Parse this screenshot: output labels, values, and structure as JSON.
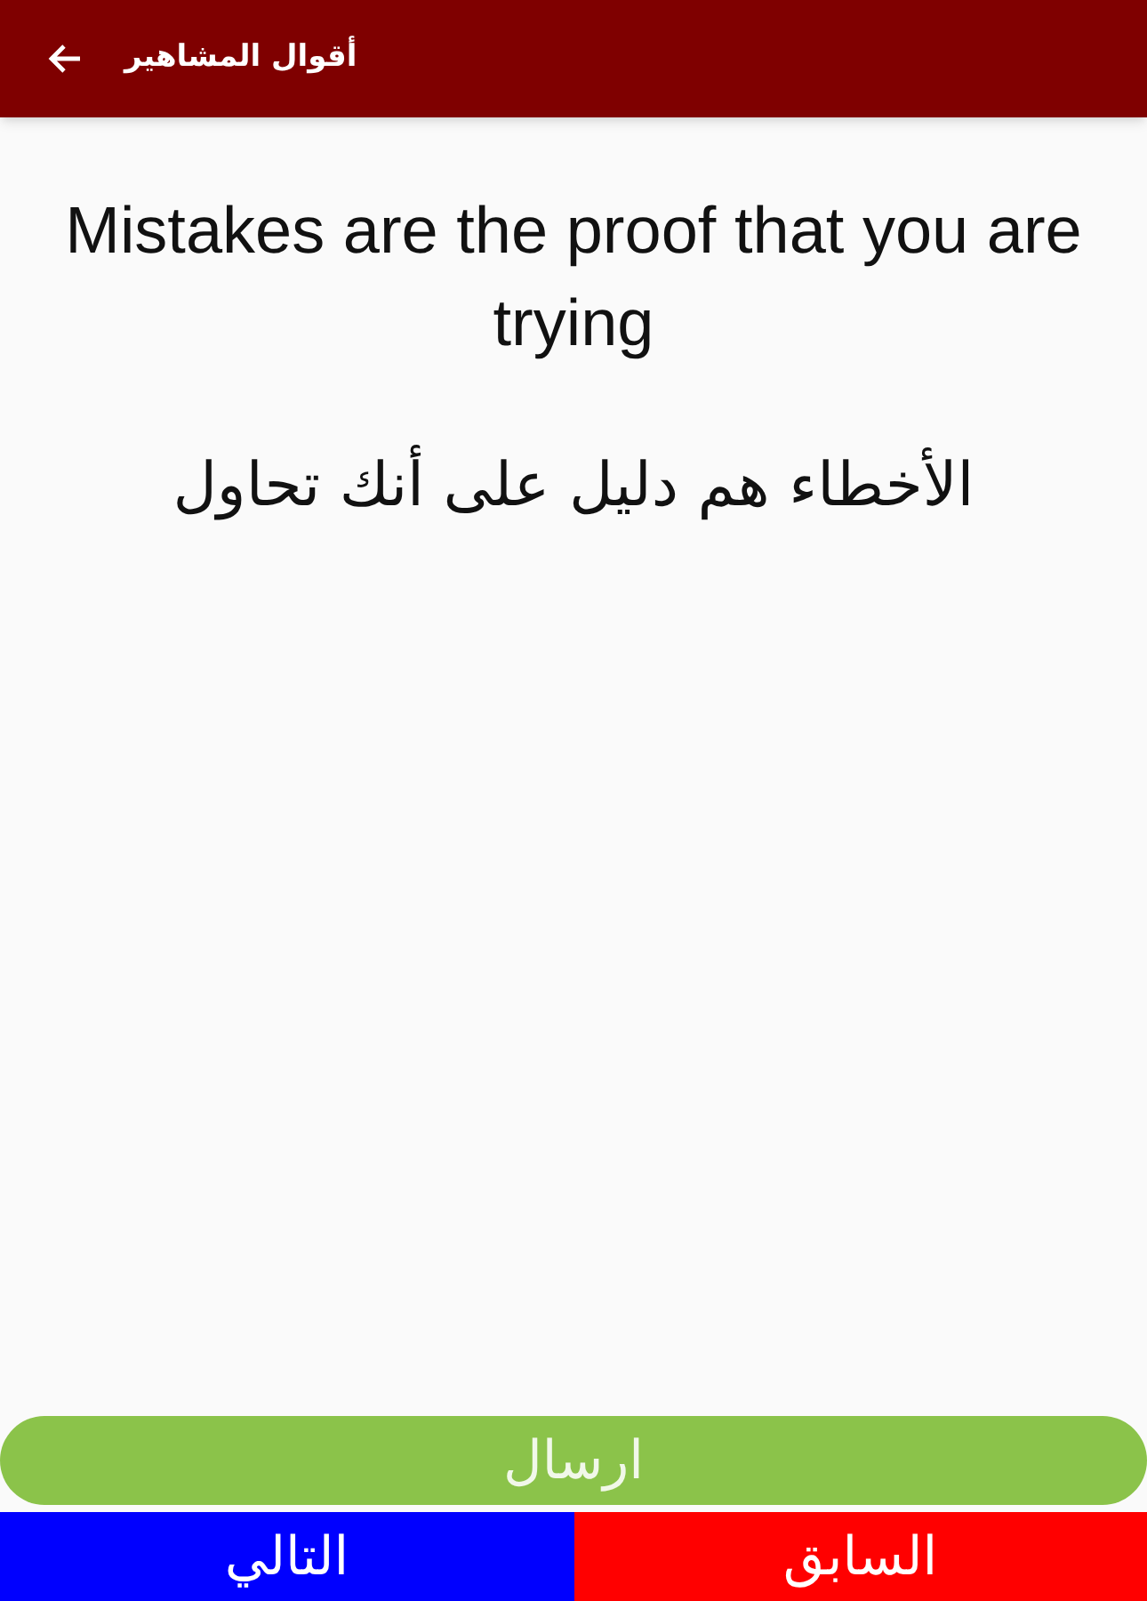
{
  "app_bar": {
    "title": "أقوال المشاهير"
  },
  "quote": {
    "english": "Mistakes are the proof that you are trying",
    "arabic": "الأخطاء هم دليل على أنك تحاول"
  },
  "send_button": {
    "label": "ارسال"
  },
  "nav_buttons": [
    {
      "kind": "previous",
      "label": "السابق"
    },
    {
      "kind": "next",
      "label": "التالي"
    }
  ]
}
